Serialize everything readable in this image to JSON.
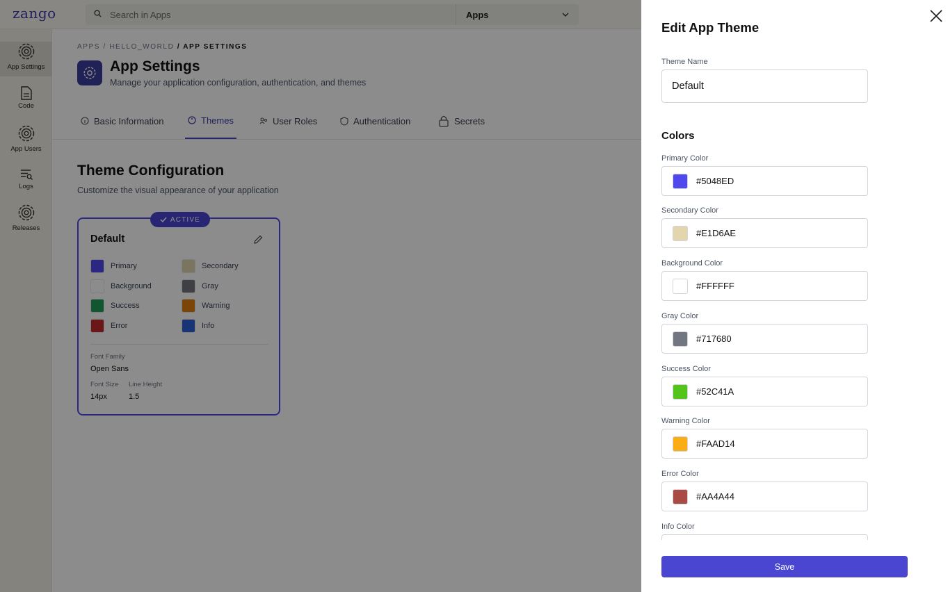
{
  "topbar": {
    "logo": "zango",
    "search_placeholder": "Search in Apps",
    "app_selector": "Apps"
  },
  "sidebar": {
    "items": [
      {
        "label": "App Settings",
        "icon": "gear-icon"
      },
      {
        "label": "Code",
        "icon": "file-icon"
      },
      {
        "label": "App Users",
        "icon": "gear-icon"
      },
      {
        "label": "Logs",
        "icon": "logs-icon"
      },
      {
        "label": "Releases",
        "icon": "gear-icon"
      }
    ]
  },
  "breadcrumb": {
    "part1": "APPS",
    "part2": "HELLO_WORLD",
    "current": "APP SETTINGS"
  },
  "header": {
    "title": "App Settings",
    "subtitle": "Manage your application configuration, authentication, and themes"
  },
  "tabs": [
    {
      "label": "Basic Information"
    },
    {
      "label": "Themes"
    },
    {
      "label": "User Roles"
    },
    {
      "label": "Authentication"
    },
    {
      "label": "Secrets"
    }
  ],
  "theme_config": {
    "title": "Theme Configuration",
    "subtitle": "Customize the visual appearance of your application"
  },
  "theme_card": {
    "badge": "ACTIVE",
    "name": "Default",
    "swatches": [
      {
        "label": "Primary",
        "color": "#5048ED"
      },
      {
        "label": "Secondary",
        "color": "#E1D6AE"
      },
      {
        "label": "Background",
        "color": "#FFFFFF"
      },
      {
        "label": "Gray",
        "color": "#717680"
      },
      {
        "label": "Success",
        "color": "#1f9d55"
      },
      {
        "label": "Warning",
        "color": "#e07f10"
      },
      {
        "label": "Error",
        "color": "#c42a2a"
      },
      {
        "label": "Info",
        "color": "#2f5fd6"
      }
    ],
    "font_family_label": "Font Family",
    "font_family": "Open Sans",
    "font_size_label": "Font Size",
    "font_size": "14px",
    "line_height_label": "Line Height",
    "line_height": "1.5"
  },
  "drawer": {
    "title": "Edit App Theme",
    "theme_name_label": "Theme Name",
    "theme_name_value": "Default",
    "colors_heading": "Colors",
    "colors": [
      {
        "label": "Primary Color",
        "value": "#5048ED"
      },
      {
        "label": "Secondary Color",
        "value": "#E1D6AE"
      },
      {
        "label": "Background Color",
        "value": "#FFFFFF"
      },
      {
        "label": "Gray Color",
        "value": "#717680"
      },
      {
        "label": "Success Color",
        "value": "#52C41A"
      },
      {
        "label": "Warning Color",
        "value": "#FAAD14"
      },
      {
        "label": "Error Color",
        "value": "#AA4A44"
      }
    ],
    "info_color_label": "Info Color",
    "save_label": "Save"
  }
}
